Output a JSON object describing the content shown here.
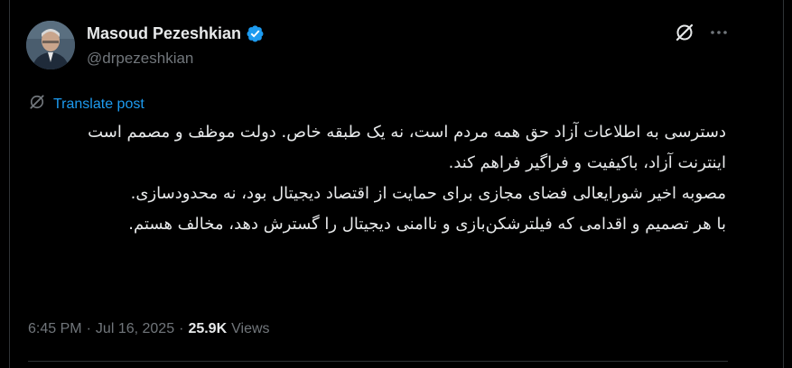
{
  "author": {
    "name": "Masoud Pezeshkian",
    "handle": "@drpezeshkian",
    "verified": true
  },
  "translate": {
    "label": "Translate post"
  },
  "post": {
    "paragraphs": [
      "دسترسی به اطلاعات آزاد حق همه مردم است، نه یک طبقه خاص. دولت موظف و مصمم است اینترنت آزاد، باکیفیت و فراگیر فراهم کند.",
      "مصوبه اخیر شورایعالی فضای مجازی برای حمایت از اقتصاد دیجیتال بود، نه محدودسازی.",
      "با هر تصمیم و اقدامی که فیلترشکن‌بازی و ناامنی دیجیتال را گسترش دهد، مخالف هستم."
    ]
  },
  "meta": {
    "time": "6:45 PM",
    "separator": "·",
    "date": "Jul 16, 2025",
    "views_count": "25.9K",
    "views_label": "Views"
  },
  "icons": {
    "verified": "verified-badge-icon",
    "grok": "grok-icon",
    "more": "more-icon",
    "translate": "translate-icon"
  },
  "colors": {
    "background": "#000000",
    "primary_text": "#e7e9ea",
    "secondary_text": "#71767b",
    "accent": "#1d9bf0",
    "border": "#2f3336"
  }
}
